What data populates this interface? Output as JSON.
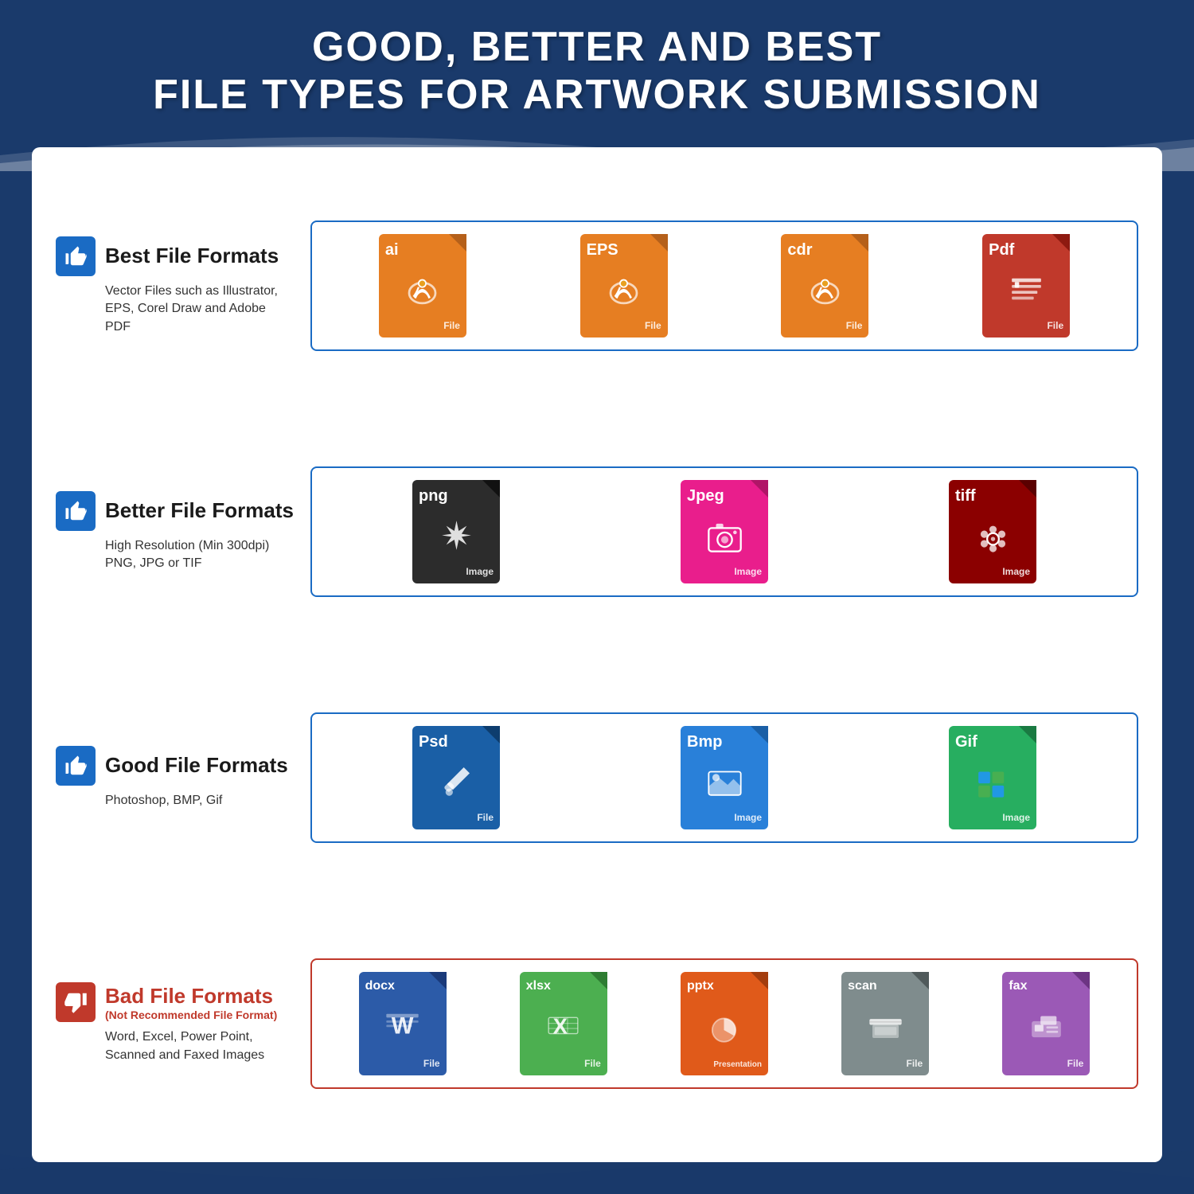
{
  "header": {
    "title_line1": "GOOD, BETTER AND BEST",
    "title_line2": "FILE TYPES FOR ARTWORK SUBMISSION",
    "bg_color": "#1a3a6b"
  },
  "rows": [
    {
      "id": "best",
      "thumb": "up",
      "thumb_color": "#1a6bc4",
      "category": "Best File Formats",
      "subtitle": null,
      "description": "Vector Files such as Illustrator,\nEPS, Corel Draw and Adobe PDF",
      "border_color": "#1a6bc4",
      "files": [
        {
          "ext": "ai",
          "color": "orange",
          "label": "File",
          "icon": "vector"
        },
        {
          "ext": "EPS",
          "color": "orange",
          "label": "File",
          "icon": "vector"
        },
        {
          "ext": "cdr",
          "color": "orange",
          "label": "File",
          "icon": "vector"
        },
        {
          "ext": "Pdf",
          "color": "red",
          "label": "File",
          "icon": "pdf"
        }
      ]
    },
    {
      "id": "better",
      "thumb": "up",
      "thumb_color": "#1a6bc4",
      "category": "Better File Formats",
      "subtitle": null,
      "description": "High Resolution (Min 300dpi)\nPNG, JPG or TIF",
      "border_color": "#1a6bc4",
      "files": [
        {
          "ext": "png",
          "color": "black",
          "label": "Image",
          "icon": "star"
        },
        {
          "ext": "Jpeg",
          "color": "pink",
          "label": "Image",
          "icon": "camera"
        },
        {
          "ext": "tiff",
          "color": "darkred",
          "label": "Image",
          "icon": "gear"
        }
      ]
    },
    {
      "id": "good",
      "thumb": "up",
      "thumb_color": "#1a6bc4",
      "category": "Good File Formats",
      "subtitle": null,
      "description": "Photoshop, BMP, Gif",
      "border_color": "#1a6bc4",
      "files": [
        {
          "ext": "Psd",
          "color": "blue",
          "label": "File",
          "icon": "brush"
        },
        {
          "ext": "Bmp",
          "color": "brightblue",
          "label": "Image",
          "icon": "landscape"
        },
        {
          "ext": "Gif",
          "color": "green",
          "label": "Image",
          "icon": "grid"
        }
      ]
    },
    {
      "id": "bad",
      "thumb": "down",
      "thumb_color": "#c0392b",
      "category": "Bad File Formats",
      "subtitle": "(Not Recommended File Format)",
      "description": "Word, Excel, Power Point,\nScanned and Faxed Images",
      "border_color": "#c0392b",
      "files": [
        {
          "ext": "docx",
          "color": "docblue",
          "label": "File",
          "icon": "word"
        },
        {
          "ext": "xlsx",
          "color": "xlsxgreen",
          "label": "File",
          "icon": "excel"
        },
        {
          "ext": "pptx",
          "color": "pptxorange",
          "label": "Presentation",
          "icon": "ppt"
        },
        {
          "ext": "scan",
          "color": "gray",
          "label": "File",
          "icon": "scan"
        },
        {
          "ext": "fax",
          "color": "purple",
          "label": "File",
          "icon": "fax"
        }
      ]
    }
  ]
}
